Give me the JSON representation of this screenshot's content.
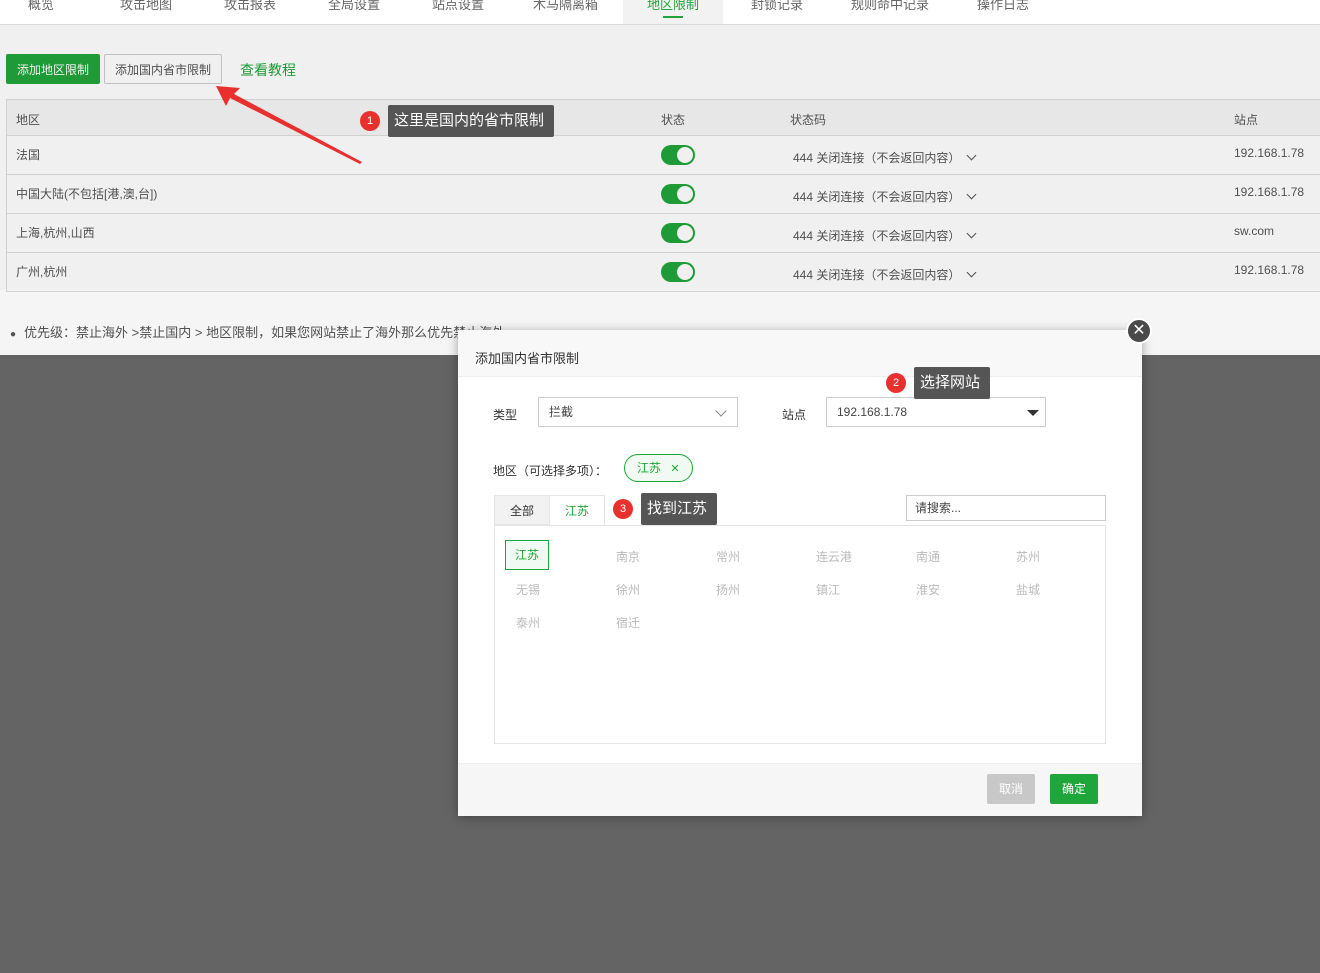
{
  "nav": {
    "tabs": [
      "概览",
      "攻击地图",
      "攻击报表",
      "全局设置",
      "站点设置",
      "木马隔离箱",
      "地区限制",
      "封锁记录",
      "规则命中记录",
      "操作日志"
    ],
    "active_index": 6
  },
  "toolbar": {
    "add_region_label": "添加地区限制",
    "add_domestic_label": "添加国内省市限制",
    "tutorial_label": "查看教程"
  },
  "table": {
    "headers": {
      "region": "地区",
      "status": "状态",
      "status_code": "状态码",
      "site": "站点"
    },
    "rows": [
      {
        "region": "法国",
        "enabled": true,
        "code": "444 关闭连接（不会返回内容）",
        "site": "192.168.1.78"
      },
      {
        "region": "中国大陆(不包括[港,澳,台])",
        "enabled": true,
        "code": "444 关闭连接（不会返回内容）",
        "site": "192.168.1.78"
      },
      {
        "region": "上海,杭州,山西",
        "enabled": true,
        "code": "444 关闭连接（不会返回内容）",
        "site": "sw.com"
      },
      {
        "region": "广州,杭州",
        "enabled": true,
        "code": "444 关闭连接（不会返回内容）",
        "site": "192.168.1.78"
      }
    ]
  },
  "note": "优先级：禁止海外 >禁止国内 > 地区限制，如果您网站禁止了海外那么优先禁止海外",
  "dialog": {
    "title": "添加国内省市限制",
    "close_glyph": "✕",
    "type_label": "类型",
    "type_value": "拦截",
    "site_label": "站点",
    "site_value": "192.168.1.78",
    "region_label": "地区（可选择多项）：",
    "selected_tag": "江苏",
    "tag_close": "✕",
    "tabs": [
      "全部",
      "江苏"
    ],
    "active_tab": 1,
    "search_placeholder": "请搜索...",
    "cities": [
      "江苏",
      "南京",
      "常州",
      "连云港",
      "南通",
      "苏州",
      "无锡",
      "徐州",
      "扬州",
      "镇江",
      "淮安",
      "盐城",
      "泰州",
      "宿迁"
    ],
    "selected_city_index": 0,
    "cancel_label": "取消",
    "confirm_label": "确定"
  },
  "callouts": [
    {
      "num": "1",
      "text": "这里是国内的省市限制"
    },
    {
      "num": "2",
      "text": "选择网站"
    },
    {
      "num": "3",
      "text": "找到江苏"
    }
  ],
  "colors": {
    "accent": "#20a53a",
    "callout_bg": "#555555",
    "badge": "#e8312f",
    "arrow": "#e8312f"
  }
}
